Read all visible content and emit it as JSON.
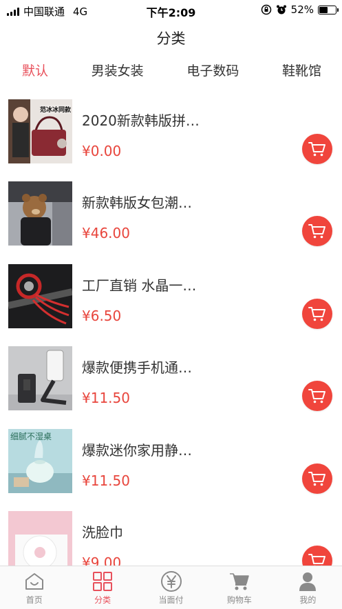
{
  "status": {
    "carrier": "中国联通",
    "network": "4G",
    "time": "下午2:09",
    "battery": "52%",
    "battery_level": 0.52
  },
  "title": "分类",
  "tabs": [
    {
      "label": "默认",
      "active": true
    },
    {
      "label": "男装女装",
      "active": false
    },
    {
      "label": "电子数码",
      "active": false
    },
    {
      "label": "鞋靴馆",
      "active": false
    }
  ],
  "products": [
    {
      "name": "2020新款韩版拼…",
      "price": "¥0.00",
      "badge": "范冰冰同款"
    },
    {
      "name": "新款韩版女包潮…",
      "price": "¥46.00"
    },
    {
      "name": "工厂直销 水晶一…",
      "price": "¥6.50"
    },
    {
      "name": "爆款便携手机通…",
      "price": "¥11.50"
    },
    {
      "name": "爆款迷你家用静…",
      "price": "¥11.50",
      "badge": "细腻不湿桌"
    },
    {
      "name": "洗脸巾",
      "price": "¥9.00"
    }
  ],
  "bottom_nav": [
    {
      "label": "首页",
      "icon": "home-icon",
      "active": false
    },
    {
      "label": "分类",
      "icon": "grid-icon",
      "active": true
    },
    {
      "label": "当面付",
      "icon": "yuan-icon",
      "active": false
    },
    {
      "label": "购物车",
      "icon": "cart-icon",
      "active": false
    },
    {
      "label": "我的",
      "icon": "user-icon",
      "active": false
    }
  ],
  "colors": {
    "accent": "#e8505b",
    "price": "#e8453c",
    "cart_button": "#f0453c"
  }
}
